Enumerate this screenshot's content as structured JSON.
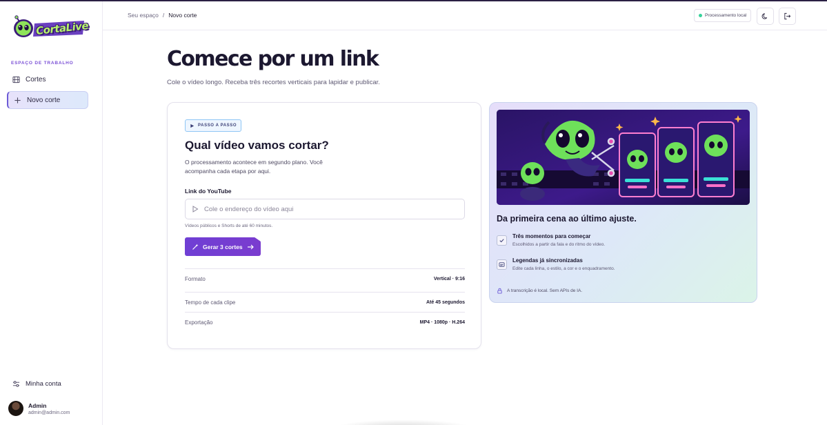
{
  "app": {
    "logo_text": "CortaLive"
  },
  "sidebar": {
    "section_label": "ESPAÇO DE TRABALHO",
    "items": [
      {
        "label": "Cortes",
        "icon": "film-icon"
      },
      {
        "label": "Novo corte",
        "icon": "plus-icon",
        "active": true
      }
    ],
    "account_label": "Minha conta",
    "user": {
      "name": "Admin",
      "email": "admin@admin.com"
    }
  },
  "header": {
    "breadcrumb": [
      "Seu espaço",
      "/",
      "Novo corte"
    ],
    "status": "Processamento local",
    "status_color": "#37d29a"
  },
  "hero": {
    "title": "Comece por um link",
    "subtitle": "Cole o vídeo longo. Receba três recortes verticais para lapidar e publicar."
  },
  "form": {
    "badge": "PASSO A PASSO",
    "title": "Qual vídeo vamos cortar?",
    "description": "O processamento acontece em segundo plano. Você acompanha cada etapa por aqui.",
    "field_label": "Link do YouTube",
    "input_value": "",
    "input_placeholder": "Cole o endereço do vídeo aqui",
    "hint": "Vídeos públicos e Shorts de até 60 minutos.",
    "button": "Gerar 3 cortes",
    "button_color": "#6f3fd4",
    "specs": [
      {
        "key": "Formato",
        "value": "Vertical · 9:16"
      },
      {
        "key": "Tempo de cada clipe",
        "value": "Até 45 segundos"
      },
      {
        "key": "Exportação",
        "value": "MP4 · 1080p · H.264"
      }
    ]
  },
  "promo": {
    "title": "Da primeira cena ao último ajuste.",
    "features": [
      {
        "title": "Três momentos para começar",
        "desc": "Escolhidos a partir da fala e do ritmo do vídeo."
      },
      {
        "title": "Legendas já sincronizadas",
        "desc": "Edite cada linha, o estilo, a cor e o enquadramento."
      }
    ],
    "privacy": "A transcrição é local. Sem APIs de IA."
  }
}
